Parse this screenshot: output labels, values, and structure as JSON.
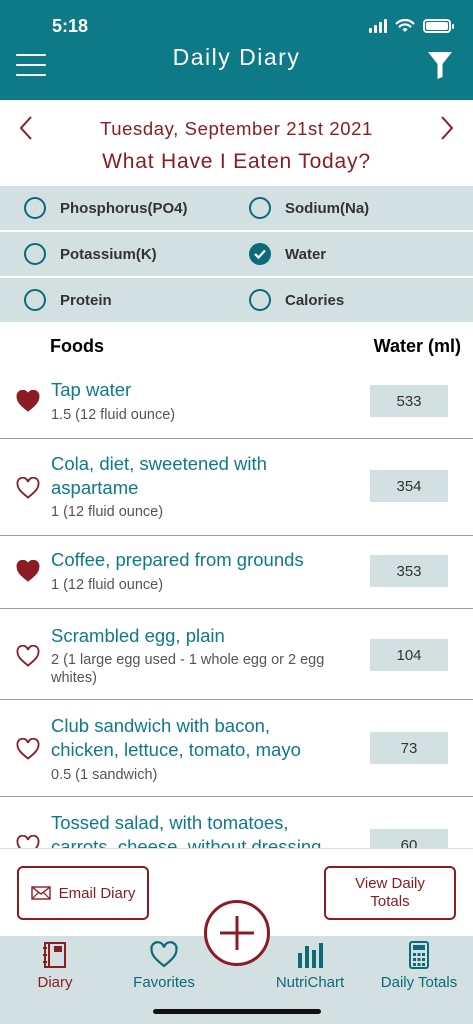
{
  "status_bar": {
    "time": "5:18"
  },
  "header": {
    "title": "Daily Diary"
  },
  "date_nav": {
    "date": "Tuesday, September 21st 2021",
    "subtitle": "What Have I Eaten Today?"
  },
  "nutrient_options": [
    {
      "label": "Phosphorus(PO4)",
      "checked": false
    },
    {
      "label": "Sodium(Na)",
      "checked": false
    },
    {
      "label": "Potassium(K)",
      "checked": false
    },
    {
      "label": "Water",
      "checked": true
    },
    {
      "label": "Protein",
      "checked": false
    },
    {
      "label": "Calories",
      "checked": false
    }
  ],
  "table": {
    "col_foods": "Foods",
    "col_value": "Water (ml)",
    "rows": [
      {
        "name": "Tap water",
        "qty": "1.5 (12 fluid ounce)",
        "value": "533",
        "favorite": true
      },
      {
        "name": "Cola, diet, sweetened with aspartame",
        "qty": "1 (12 fluid ounce)",
        "value": "354",
        "favorite": false
      },
      {
        "name": "Coffee, prepared from grounds",
        "qty": "1 (12 fluid ounce)",
        "value": "353",
        "favorite": true
      },
      {
        "name": "Scrambled egg, plain",
        "qty": "2 (1 large egg used - 1 whole egg or 2 egg whites)",
        "value": "104",
        "favorite": false
      },
      {
        "name": "Club sandwich with bacon, chicken, lettuce, tomato, mayo",
        "qty": "0.5 (1 sandwich)",
        "value": "73",
        "favorite": false
      },
      {
        "name": "Tossed salad, with tomatoes, carrots, cheese, without dressing",
        "qty": "",
        "value": "60",
        "favorite": false
      }
    ]
  },
  "actions": {
    "email_label": "Email Diary",
    "totals_label": "View Daily Totals"
  },
  "tabs": [
    {
      "label": "Diary"
    },
    {
      "label": "Favorites"
    },
    {
      "label": "NutriChart"
    },
    {
      "label": "Daily Totals"
    }
  ],
  "colors": {
    "teal": "#0e7a87",
    "maroon": "#8b1c24",
    "panel": "#d2e0e2"
  }
}
